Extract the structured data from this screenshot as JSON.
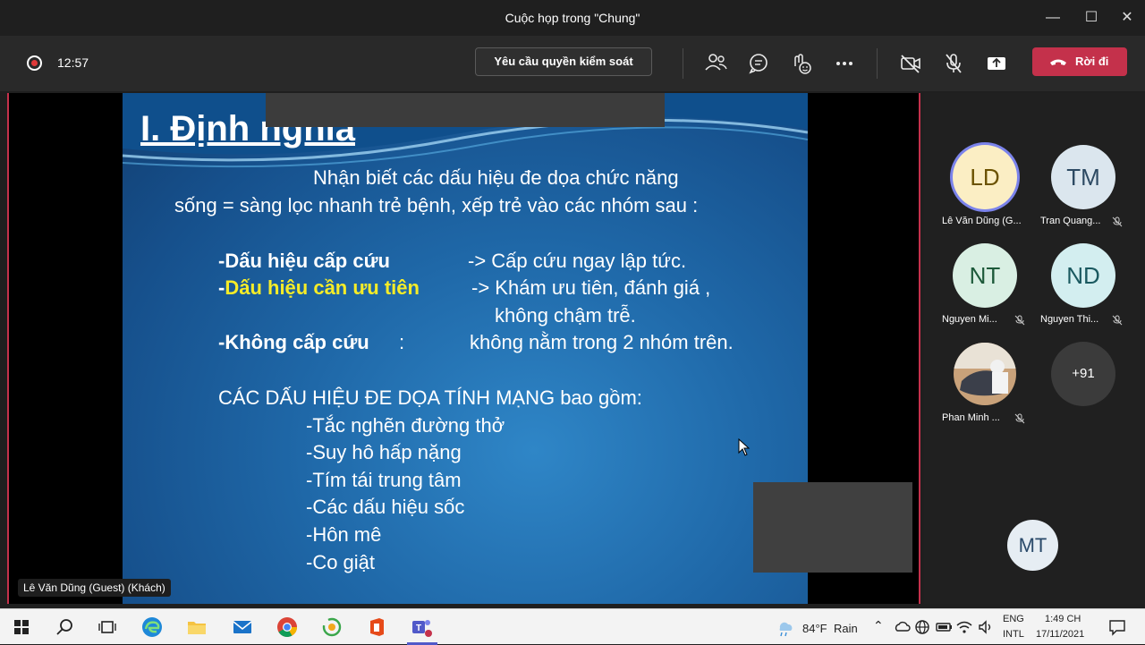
{
  "window": {
    "title": "Cuộc họp trong \"Chung\""
  },
  "toolbar": {
    "timer": "12:57",
    "request_control": "Yêu cầu quyền kiểm soát",
    "leave": "Rời đi"
  },
  "slide": {
    "heading": "I. Định nghĩa",
    "intro_1": "Nhận biết các dấu hiệu đe dọa chức năng",
    "intro_2": "sống = sàng lọc nhanh trẻ bệnh, xếp trẻ vào các nhóm sau :",
    "groups": [
      {
        "label": "-Dấu hiệu cấp cứu",
        "action": "-> Cấp cứu ngay lập tức."
      },
      {
        "prefix": "-",
        "label": "Dấu hiệu cần ưu tiên",
        "action": "-> Khám ưu tiên, đánh giá ,",
        "action_cont": "không chậm trễ."
      },
      {
        "label": "-Không cấp cứu",
        "sep": ":",
        "action": "không nằm trong 2 nhóm trên."
      }
    ],
    "danger_heading": "CÁC DẤU HIỆU ĐE DỌA TÍNH MẠNG  bao gồm:",
    "danger_signs": [
      "-Tắc nghẽn đường thở",
      "-Suy hô hấp nặng",
      "-Tím tái trung tâm",
      "-Các dấu hiệu sốc",
      "-Hôn mê",
      "-Co giật"
    ]
  },
  "presenter_tag": "Lê Văn Dũng (Guest) (Khách)",
  "participants": [
    {
      "initials": "LD",
      "name": "Lê Văn Dũng (G...",
      "muted": false,
      "active": true,
      "bg": "#fbeec4",
      "fg": "#6b5200"
    },
    {
      "initials": "TM",
      "name": "Tran Quang...",
      "muted": true,
      "bg": "#dbe6ee",
      "fg": "#2d4a63"
    },
    {
      "initials": "NT",
      "name": "Nguyen Mi...",
      "muted": true,
      "bg": "#d9efe3",
      "fg": "#1d5a3a"
    },
    {
      "initials": "ND",
      "name": "Nguyen Thi...",
      "muted": true,
      "bg": "#d3eef0",
      "fg": "#1b5960"
    },
    {
      "initials": "",
      "name": "Phan Minh ...",
      "muted": true,
      "photo": true
    },
    {
      "initials": "+91",
      "name": "",
      "muted": false,
      "more": true
    }
  ],
  "self_avatar": "MT",
  "taskbar": {
    "weather_temp": "84°F",
    "weather_desc": "Rain",
    "lang_1": "ENG",
    "lang_2": "INTL",
    "time": "1:49 CH",
    "date": "17/11/2021"
  },
  "colors": {
    "leave": "#c4314b",
    "accent": "#7b83eb",
    "record": "#e03a3a"
  }
}
